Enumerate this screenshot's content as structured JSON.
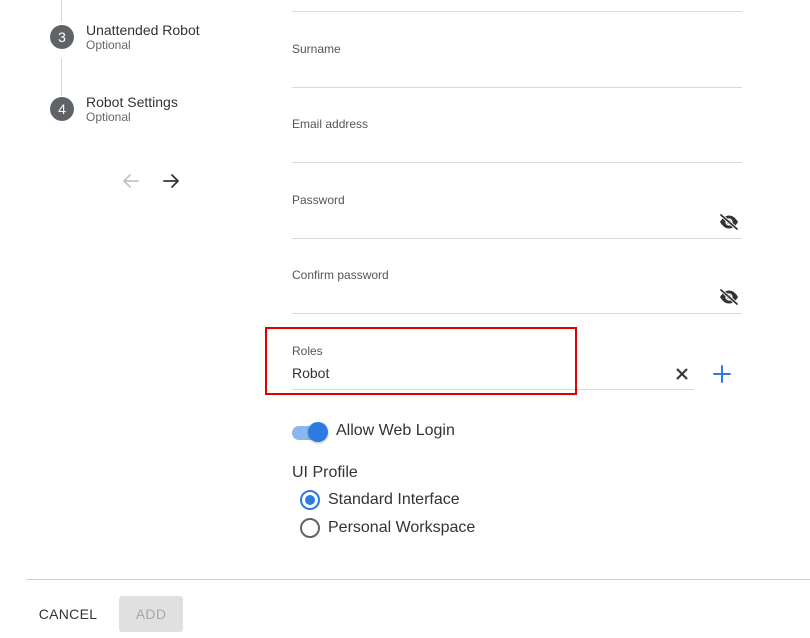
{
  "stepper": {
    "steps": [
      {
        "number": "3",
        "title": "Unattended Robot",
        "subtitle": "Optional"
      },
      {
        "number": "4",
        "title": "Robot Settings",
        "subtitle": "Optional"
      }
    ]
  },
  "form": {
    "surname": {
      "label": "Surname",
      "value": ""
    },
    "email": {
      "label": "Email address",
      "value": ""
    },
    "password": {
      "label": "Password",
      "value": ""
    },
    "confirm_password": {
      "label": "Confirm password",
      "value": ""
    },
    "roles": {
      "label": "Roles",
      "value": "Robot"
    },
    "allow_web_login": {
      "label": "Allow Web Login",
      "enabled": true
    },
    "ui_profile": {
      "title": "UI Profile",
      "options": [
        {
          "label": "Standard Interface",
          "selected": true
        },
        {
          "label": "Personal Workspace",
          "selected": false
        }
      ]
    }
  },
  "footer": {
    "cancel_label": "CANCEL",
    "add_label": "ADD"
  },
  "colors": {
    "accent": "#2d7be0",
    "highlight": "#e00000",
    "step_circle": "#5f6368"
  }
}
